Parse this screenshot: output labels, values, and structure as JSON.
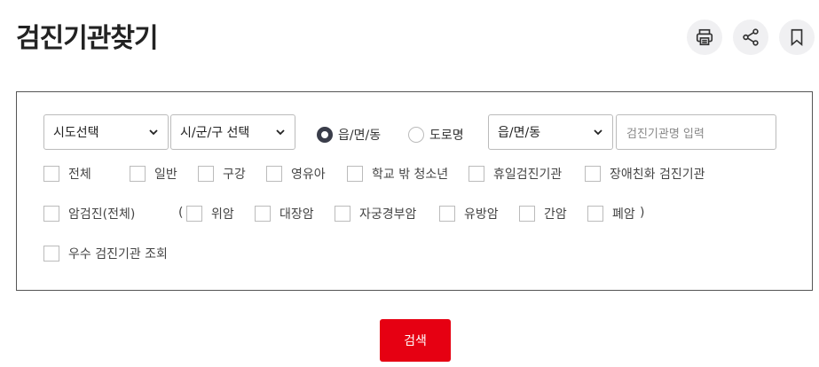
{
  "page": {
    "title": "검진기관찾기"
  },
  "toolbar": {
    "print_icon": "printer-icon",
    "share_icon": "share-icon",
    "bookmark_icon": "bookmark-icon"
  },
  "filters": {
    "sido_select": "시도선택",
    "sigungu_select": "시/군/구 선택",
    "address_type": {
      "options": [
        {
          "label": "읍/면/동",
          "checked": true
        },
        {
          "label": "도로명",
          "checked": false
        }
      ]
    },
    "dong_select": "읍/면/동",
    "name_input_placeholder": "검진기관명 입력"
  },
  "checkboxes": {
    "row1": [
      "전체",
      "일반",
      "구강",
      "영유아",
      "학교 밖 청소년",
      "휴일검진기관",
      "장애친화 검진기관"
    ],
    "row2": [
      "암검진(전체)",
      "위암",
      "대장암",
      "자궁경부암",
      "유방암",
      "간암",
      "폐암"
    ],
    "row2_open_paren": "(",
    "row2_close_paren": ")",
    "row3": [
      "우수 검진기관 조회"
    ]
  },
  "actions": {
    "search_label": "검색"
  },
  "colors": {
    "accent": "#e60012",
    "radio_checked": "#3a3d4a",
    "icon_bg": "#f0f0f2"
  }
}
